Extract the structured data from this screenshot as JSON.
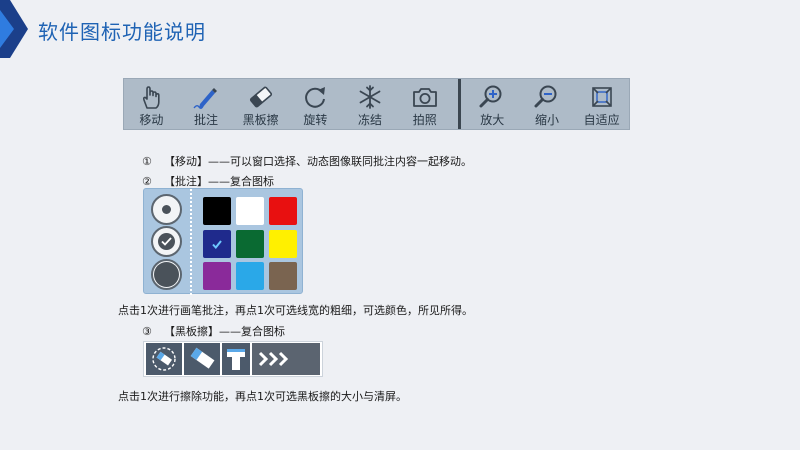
{
  "title": "软件图标功能说明",
  "toolbar": {
    "items": [
      {
        "label": "移动",
        "icon": "hand-move-icon"
      },
      {
        "label": "批注",
        "icon": "pen-annotate-icon"
      },
      {
        "label": "黑板擦",
        "icon": "eraser-icon"
      },
      {
        "label": "旋转",
        "icon": "rotate-icon"
      },
      {
        "label": "冻结",
        "icon": "snowflake-freeze-icon"
      },
      {
        "label": "拍照",
        "icon": "camera-icon"
      },
      {
        "label": "放大",
        "icon": "zoom-in-icon"
      },
      {
        "label": "缩小",
        "icon": "zoom-out-icon"
      },
      {
        "label": "自适应",
        "icon": "fit-screen-icon"
      }
    ]
  },
  "desc": {
    "item1_num": "①",
    "item1_text": "【移动】——可以窗口选择、动态图像联同批注内容一起移动。",
    "item2_num": "②",
    "item2_text": "【批注】——复合图标",
    "item2_note": "点击1次进行画笔批注，再点1次可选线宽的粗细，可选颜色，所见所得。",
    "item3_num": "③",
    "item3_text": "【黑板擦】——复合图标",
    "item3_note": "点击1次进行擦除功能，再点1次可选黑板擦的大小与清屏。"
  },
  "palette": {
    "selected_width": "medium",
    "selected_color": "#1f2a8c",
    "colors": [
      "#000000",
      "#ffffff",
      "#e81010",
      "#1f2a8c",
      "#0a6a32",
      "#fff000",
      "#8a2a9a",
      "#2aa8e8",
      "#7a6450"
    ]
  },
  "accent": "#1f63b4"
}
